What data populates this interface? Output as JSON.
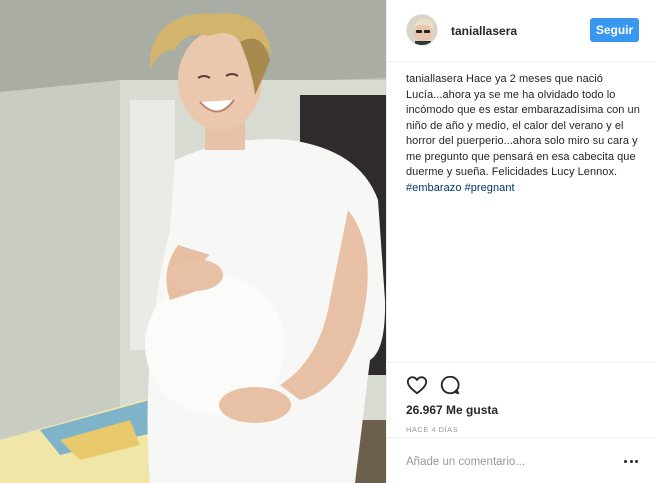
{
  "post": {
    "username": "taniallasera",
    "follow_label": "Seguir",
    "caption": {
      "user": "taniallasera",
      "text": "Hace ya 2 meses que nació Lucía...ahora ya se me ha olvidado todo lo incómodo que es estar embarazadísima con un niño de año y medio, el calor del verano y el horror del puerperio...ahora solo miro su cara y me pregunto que pensará en esa cabecita que duerme y sueña. Felicidades Lucy Lennox.",
      "hashtags": [
        "#embarazo",
        "#pregnant"
      ]
    },
    "likes": "26.967 Me gusta",
    "timestamp": "HACE 4 DÍAS",
    "comment_placeholder": "Añade un comentario..."
  },
  "icons": {
    "like": "heart-outline-icon",
    "comment": "speech-bubble-icon",
    "more": "ellipsis-icon"
  },
  "colors": {
    "follow_button": "#3897f0",
    "hashtag": "#003569",
    "muted_text": "#999999",
    "divider": "#efefef"
  }
}
